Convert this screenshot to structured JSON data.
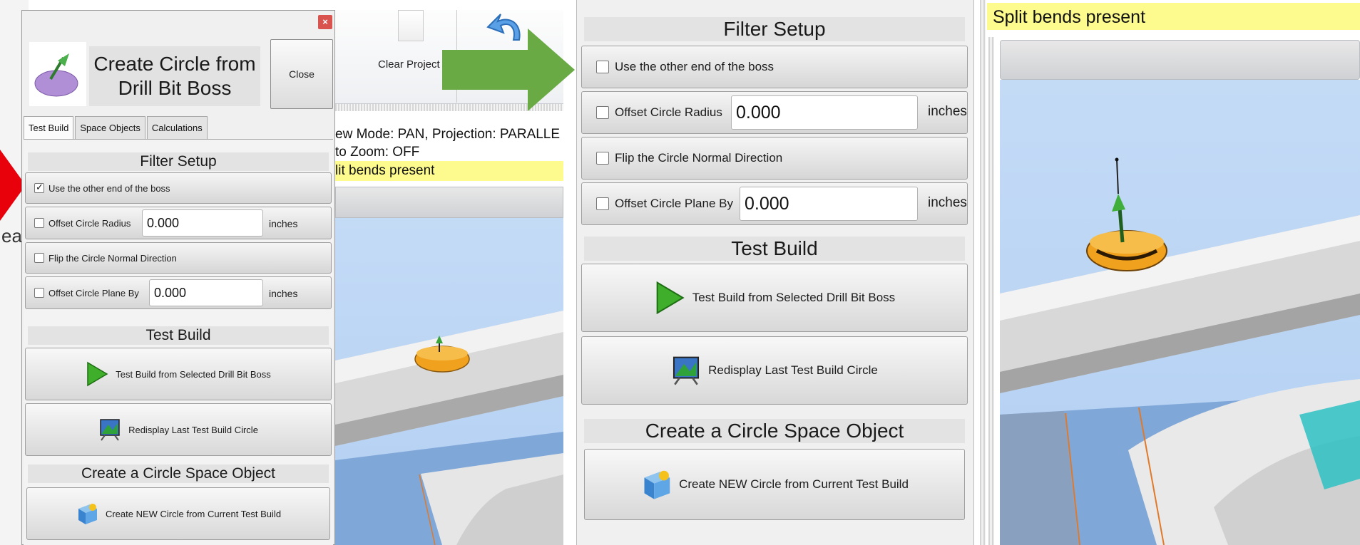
{
  "dialog": {
    "title": "Create Circle from Drill Bit Boss",
    "close_label": "Close",
    "close_x": "×",
    "tabs": [
      "Test Build",
      "Space Objects",
      "Calculations"
    ]
  },
  "filter_setup": {
    "heading": "Filter Setup",
    "use_other_end": {
      "label": "Use the other end of the boss",
      "checked_left": true,
      "checked_mid": false
    },
    "offset_radius": {
      "label": "Offset Circle Radius",
      "value": "0.000",
      "unit": "inches"
    },
    "flip_normal": {
      "label": "Flip the Circle Normal Direction"
    },
    "offset_plane": {
      "label": "Offset Circle Plane By",
      "value": "0.000",
      "unit": "inches"
    }
  },
  "test_build": {
    "heading": "Test Build",
    "build_button": "Test Build from Selected Drill Bit Boss",
    "redisplay_button": "Redisplay Last Test Build Circle"
  },
  "create_section": {
    "heading": "Create a Circle Space Object",
    "create_button": "Create NEW Circle from Current Test Build"
  },
  "background_app": {
    "ribbon": {
      "clear_project": "Clear Project",
      "undo_partial": "Undo Previous"
    },
    "status_line_1": "ew Mode: PAN, Projection: PARALLE",
    "status_line_2": "to Zoom: OFF",
    "status_split_left": "lit bends present",
    "left_edge_text": "ea"
  },
  "right_panel": {
    "status_split": "Split bends present"
  },
  "colors": {
    "arrow_green": "#6aaa45",
    "arrow_red": "#e8000b",
    "status_yellow": "#fdfb8e",
    "viewport_blue": "#b9d3f3",
    "boss_orange": "#f0a11e",
    "teal": "#2ec1c3"
  }
}
